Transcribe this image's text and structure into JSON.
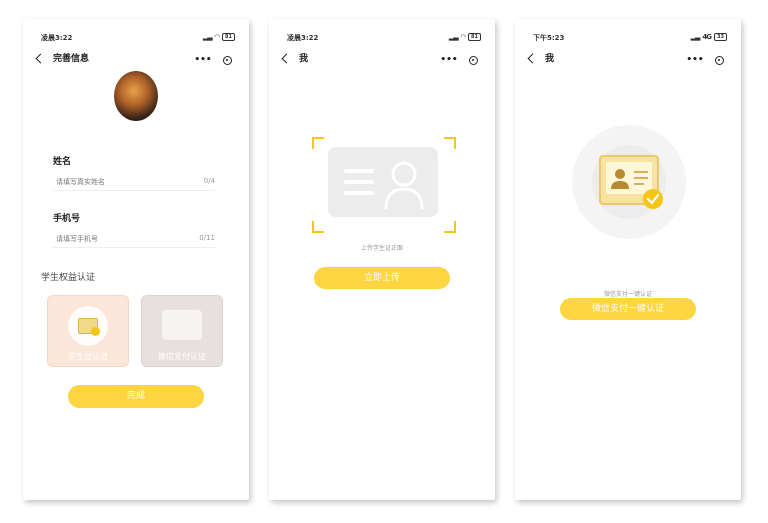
{
  "screens": [
    {
      "time": "凌晨3:22",
      "battery": "81",
      "nav_title": "完善信息",
      "fields": [
        {
          "label": "姓名",
          "placeholder": "请填写真实姓名",
          "count": "0/4"
        },
        {
          "label": "手机号",
          "placeholder": "请填写手机号",
          "count": "0/11"
        }
      ],
      "section_title": "学生权益认证",
      "cards": [
        {
          "label": "学生证认证"
        },
        {
          "label": "微信支付认证"
        }
      ],
      "button": "完成"
    },
    {
      "time": "凌晨3:22",
      "battery": "81",
      "nav_title": "我",
      "hint": "上传学生证正面",
      "button": "立即上传"
    },
    {
      "time": "下午5:23",
      "battery": "33",
      "network": "4G",
      "nav_title": "我",
      "hint": "微信支付一键认证",
      "button": "微信支付一键认证"
    }
  ],
  "colors": {
    "accent": "#fcd540",
    "check": "#f5c518"
  },
  "icons": [
    "back-arrow-icon",
    "more-dots-icon",
    "capsule-target-icon",
    "id-card-icon",
    "check-icon",
    "wifi-icon",
    "signal-icon",
    "battery-icon"
  ]
}
